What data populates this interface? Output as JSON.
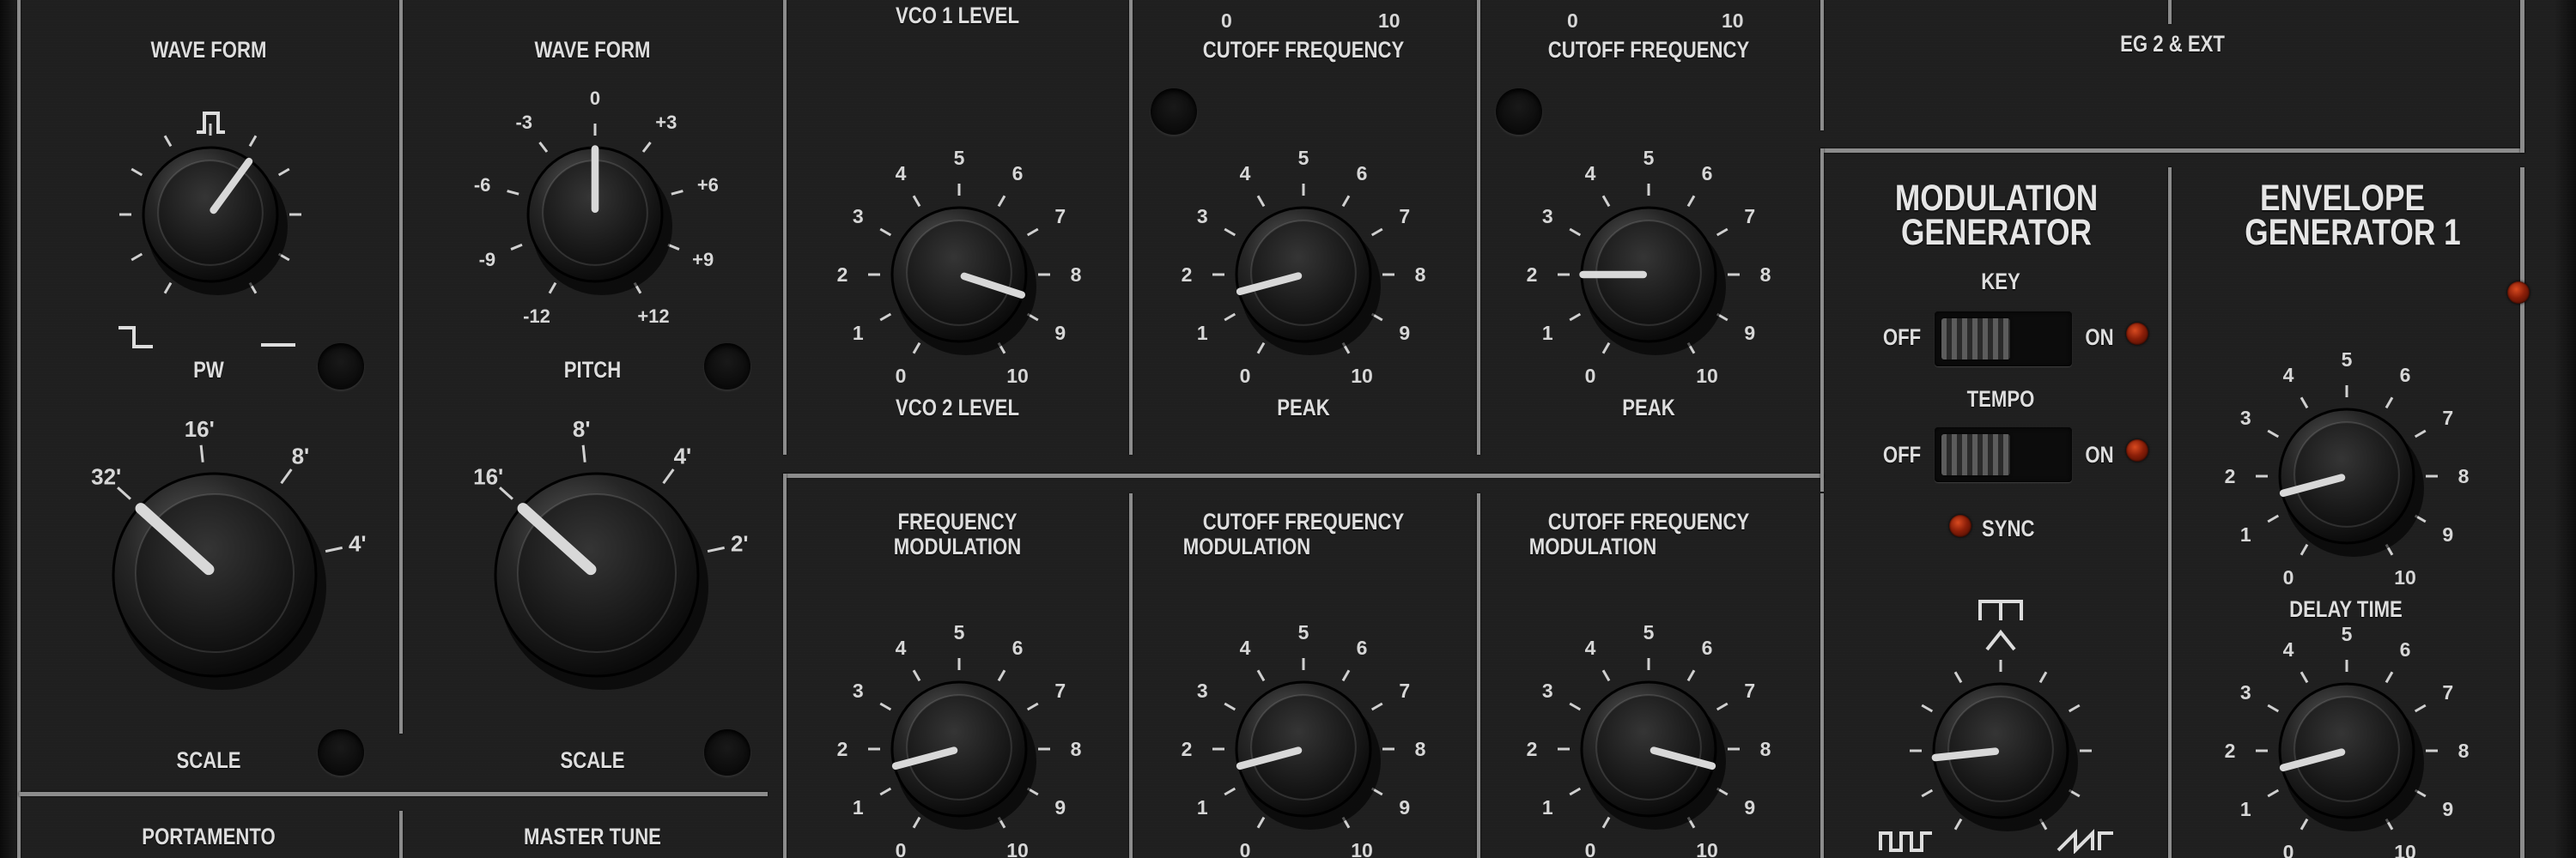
{
  "osc1": {
    "waveform_label": "WAVE FORM",
    "pw_label": "PW",
    "scale_label": "SCALE",
    "scale_marks": [
      "32'",
      "16'",
      "8'",
      "4'"
    ]
  },
  "osc2": {
    "waveform_label": "WAVE FORM",
    "pitch_label": "PITCH",
    "pitch_marks": [
      "-12",
      "-9",
      "-6",
      "-3",
      "0",
      "+3",
      "+6",
      "+9",
      "+12"
    ],
    "scale_label": "SCALE",
    "scale_marks": [
      "16'",
      "8'",
      "4'",
      "2'"
    ]
  },
  "bottom_left": {
    "portamento_label": "PORTAMENTO",
    "master_tune_label": "MASTER TUNE"
  },
  "mixer": {
    "vco1_level_label": "VCO 1 LEVEL",
    "vco2_level_label": "VCO 2 LEVEL"
  },
  "hpf": {
    "cutoff_label": "CUTOFF FREQUENCY",
    "peak_label": "PEAK"
  },
  "lpf": {
    "cutoff_label": "CUTOFF FREQUENCY",
    "peak_label": "PEAK"
  },
  "eg2_label": "EG 2 & EXT",
  "mod_row": {
    "freq_mod_label_1": "FREQUENCY",
    "freq_mod_label_2": "MODULATION",
    "hpf_cut_mod_label_1": "CUTOFF FREQUENCY",
    "hpf_cut_mod_label_2": "MODULATION",
    "lpf_cut_mod_label_1": "CUTOFF FREQUENCY",
    "lpf_cut_mod_label_2": "MODULATION"
  },
  "modgen": {
    "title_1": "MODULATION",
    "title_2": "GENERATOR",
    "key_label": "KEY",
    "tempo_label": "TEMPO",
    "off_label": "OFF",
    "on_label": "ON",
    "sync_label": "SYNC"
  },
  "eg1": {
    "title_1": "ENVELOPE",
    "title_2": "GENERATOR 1",
    "delay_label": "DELAY TIME"
  },
  "scale_numbers": [
    "0",
    "1",
    "2",
    "3",
    "4",
    "5",
    "6",
    "7",
    "8",
    "9",
    "10"
  ],
  "knobs": {
    "pw": 0.62,
    "osc1_scale": 0.0,
    "osc2_pitch": 0.5,
    "osc2_scale": 0.0,
    "vco2_level": 0.86,
    "hpf_peak": 0.15,
    "lpf_peak": 0.2,
    "freq_mod": 0.15,
    "hpf_cut_mod": 0.15,
    "lpf_cut_mod": 0.85,
    "mg_waveform": 0.18,
    "eg1_delay": 0.15,
    "eg1_second": 0.15
  },
  "colors": {
    "panel": "#1f1f1f",
    "trim_line": "#8c8c8c",
    "label_text": "#dedede",
    "led_red": "#8a1e08"
  }
}
